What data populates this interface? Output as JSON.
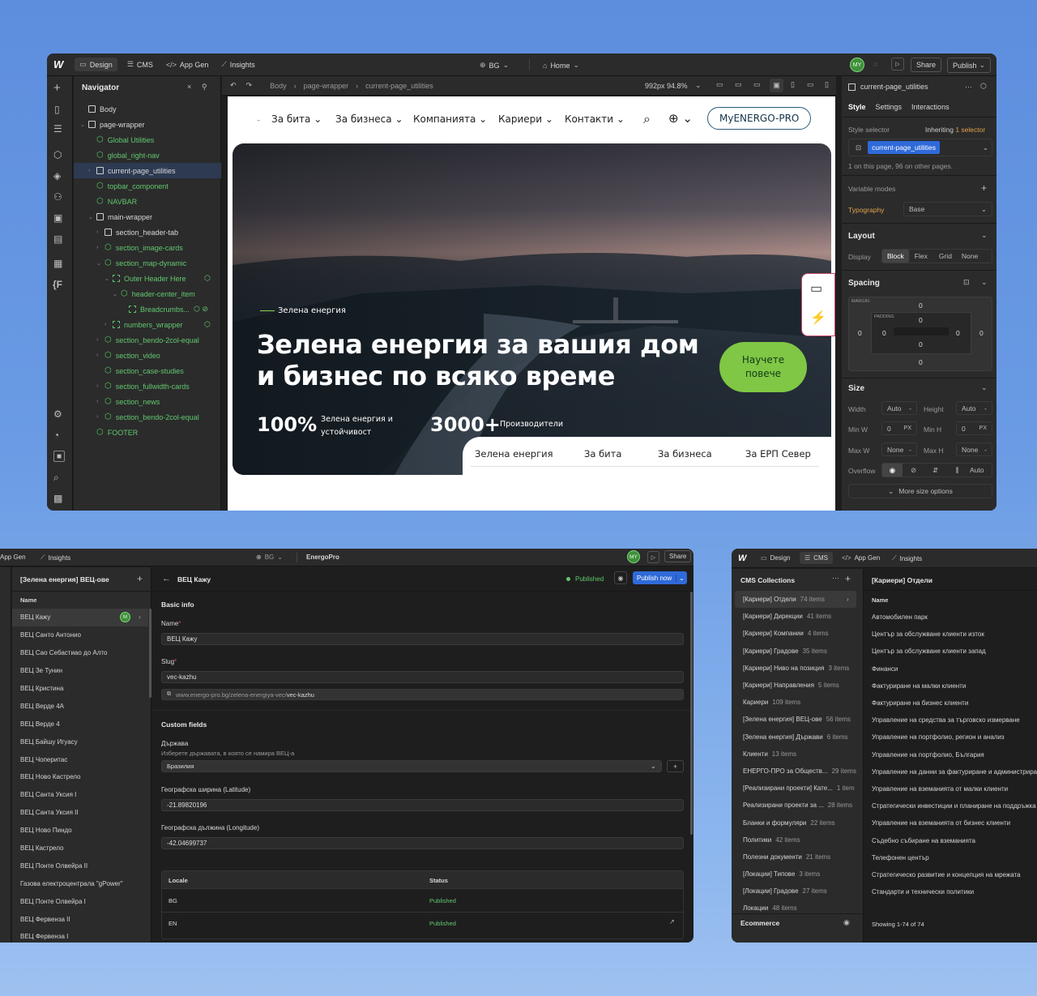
{
  "main": {
    "top": {
      "design": "Design",
      "cms": "CMS",
      "appgen": "App Gen",
      "insights": "Insights",
      "locale": "BG",
      "page": "Home",
      "avatar": "MY",
      "share": "Share",
      "publish": "Publish"
    },
    "navigator": {
      "title": "Navigator",
      "items": [
        {
          "label": "Body",
          "kind": "box",
          "depth": 0,
          "caret": ""
        },
        {
          "label": "page-wrapper",
          "kind": "box",
          "depth": 0,
          "caret": "v"
        },
        {
          "label": "Global Utilities",
          "kind": "comp",
          "depth": 1,
          "caret": ""
        },
        {
          "label": "global_right-nav",
          "kind": "comp",
          "depth": 1,
          "caret": ""
        },
        {
          "label": "current-page_utilities",
          "kind": "box",
          "depth": 1,
          "caret": ">",
          "selected": true
        },
        {
          "label": "topbar_component",
          "kind": "comp",
          "depth": 1,
          "caret": ""
        },
        {
          "label": "NAVBAR",
          "kind": "comp",
          "depth": 1,
          "caret": ""
        },
        {
          "label": "main-wrapper",
          "kind": "box",
          "depth": 1,
          "caret": "v"
        },
        {
          "label": "section_header-tab",
          "kind": "box",
          "depth": 2,
          "caret": ">"
        },
        {
          "label": "section_image-cards",
          "kind": "comp",
          "depth": 2,
          "caret": ">"
        },
        {
          "label": "section_map-dynamic",
          "kind": "comp",
          "depth": 2,
          "caret": "v"
        },
        {
          "label": "Outer Header Here",
          "kind": "dash",
          "depth": 3,
          "caret": "v"
        },
        {
          "label": "header-center_item",
          "kind": "comp",
          "depth": 4,
          "caret": "v"
        },
        {
          "label": "Breadcrumbs...",
          "kind": "dash",
          "depth": 5,
          "caret": ""
        },
        {
          "label": "numbers_wrapper",
          "kind": "dash",
          "depth": 3,
          "caret": ">"
        },
        {
          "label": "section_bendo-2col-equal",
          "kind": "comp",
          "depth": 2,
          "caret": ">"
        },
        {
          "label": "section_video",
          "kind": "comp",
          "depth": 2,
          "caret": ">"
        },
        {
          "label": "section_case-studies",
          "kind": "comp",
          "depth": 2,
          "caret": ""
        },
        {
          "label": "section_fullwidth-cards",
          "kind": "comp",
          "depth": 2,
          "caret": ">"
        },
        {
          "label": "section_news",
          "kind": "comp",
          "depth": 2,
          "caret": ">"
        },
        {
          "label": "section_bendo-2col-equal",
          "kind": "comp",
          "depth": 2,
          "caret": ">"
        },
        {
          "label": "FOOTER",
          "kind": "comp",
          "depth": 1,
          "caret": ""
        }
      ]
    },
    "crumbs": [
      "Body",
      "page-wrapper",
      "current-page_utilities"
    ],
    "viewport": "992px 94.8%",
    "site": {
      "nav": [
        "За бита",
        "За бизнеса",
        "Компанията",
        "Кариери",
        "Контакти"
      ],
      "cta": "MyENERGO-PRO",
      "eyebrow": "Зелена енергия",
      "headline1": "Зелена енергия за вашия дом",
      "headline2": "и бизнес по всяко време",
      "button": "Научете повече",
      "stat1_value": "100%",
      "stat1_label": "Зелена енергия и устойчивост",
      "stat2_value": "3000+",
      "stat2_label": "Производители",
      "tabs": [
        "Зелена енергия",
        "За бита",
        "За бизнеса",
        "За ЕРП Север"
      ]
    },
    "style": {
      "class_name": "current-page_utilities",
      "tabs": [
        "Style",
        "Settings",
        "Interactions"
      ],
      "selector_label": "Style selector",
      "inheriting": "Inheriting",
      "selector_count": "1 selector",
      "usage": "1 on this page, 96 on other pages.",
      "variable_modes": "Variable modes",
      "typography": "Typography",
      "base": "Base",
      "layout": "Layout",
      "display": "Display",
      "display_opts": [
        "Block",
        "Flex",
        "Grid",
        "None"
      ],
      "spacing": "Spacing",
      "margin": "MARGIN",
      "padding": "PADDING",
      "zero": "0",
      "size": "Size",
      "width": "Width",
      "height": "Height",
      "auto": "Auto",
      "minw": "Min W",
      "minh": "Min H",
      "maxw": "Max W",
      "maxh": "Max H",
      "none": "None",
      "px": "PX",
      "overflow": "Overflow",
      "more": "More size options"
    }
  },
  "cms_left": {
    "top": {
      "appgen": "App Gen",
      "insights": "Insights",
      "locale": "BG",
      "site": "EnergoPro",
      "avatar": "MY",
      "share": "Share"
    },
    "collection": "[Зелена енергия] ВЕЦ-ове",
    "name_header": "Name",
    "items": [
      "ВЕЦ Кажу",
      "ВЕЦ Санто Антонио",
      "ВЕЦ Сао Себастиао до Алто",
      "ВЕЦ Зе Тунин",
      "ВЕЦ Кристина",
      "ВЕЦ Верде 4А",
      "ВЕЦ Верде 4",
      "ВЕЦ Байшу Игуасу",
      "ВЕЦ Чоперитас",
      "ВЕЦ Ново Кастрело",
      "ВЕЦ Санта Уксия I",
      "ВЕЦ Санта Уксия II",
      "ВЕЦ Ново Пиндо",
      "ВЕЦ Кастрело",
      "ВЕЦ Понте Олвейра II",
      "Газова електроцентрала \"gPower\"",
      "ВЕЦ Понте Олвейра I",
      "ВЕЦ Фервенза II",
      "ВЕЦ Фервенза I"
    ],
    "item_title": "ВЕЦ Кажу",
    "status": "Published",
    "publish_now": "Publish now",
    "basic_info": "Basic info",
    "name_label": "Name",
    "name_value": "ВЕЦ Кажу",
    "slug_label": "Slug",
    "slug_value": "vec-kazhu",
    "url_prefix": "www.energo-pro.bg/zelena-energiya-vec/",
    "url_slug": "vec-kazhu",
    "custom_fields": "Custom fields",
    "country_label": "Държава",
    "country_help": "Изберете държавата, в която се намира ВЕЦ-а",
    "country_value": "Бразилия",
    "lat_label": "Географска ширина (Latitude)",
    "lat_value": "-21.89820196",
    "lng_label": "Географска дължина (Longitude)",
    "lng_value": "-42.04699737",
    "locale_header": "Locale",
    "status_header": "Status",
    "locales": [
      {
        "code": "BG",
        "status": "Published"
      },
      {
        "code": "EN",
        "status": "Published"
      }
    ]
  },
  "cms_right": {
    "top": {
      "design": "Design",
      "cms": "CMS",
      "appgen": "App Gen",
      "insights": "Insights"
    },
    "title": "CMS Collections",
    "collections": [
      {
        "name": "[Кариери] Отдели",
        "count": "74 items"
      },
      {
        "name": "[Кариери] Дирекции",
        "count": "41 items"
      },
      {
        "name": "[Кариери] Компании",
        "count": "4 items"
      },
      {
        "name": "[Кариери] Градове",
        "count": "35 items"
      },
      {
        "name": "[Кариери] Ниво на позиция",
        "count": "3 items"
      },
      {
        "name": "[Кариери] Направления",
        "count": "5 items"
      },
      {
        "name": "Кариери",
        "count": "109 items"
      },
      {
        "name": "[Зелена енергия] ВЕЦ-ове",
        "count": "56 items"
      },
      {
        "name": "[Зелена енергия] Държави",
        "count": "6 items"
      },
      {
        "name": "Клиенти",
        "count": "13 items"
      },
      {
        "name": "ЕНЕРГО-ПРО за Обществ...",
        "count": "29 items"
      },
      {
        "name": "[Реализирани проекти] Кате...",
        "count": "1 item"
      },
      {
        "name": "Реализирани проекти за ...",
        "count": "28 items"
      },
      {
        "name": "Бланки и формуляри",
        "count": "22 items"
      },
      {
        "name": "Политики",
        "count": "42 items"
      },
      {
        "name": "Полезни документи",
        "count": "21 items"
      },
      {
        "name": "[Локации] Типове",
        "count": "3 items"
      },
      {
        "name": "[Локации] Градове",
        "count": "27 items"
      },
      {
        "name": "Локации",
        "count": "48 items"
      }
    ],
    "ecommerce": "Ecommerce",
    "collection": "[Кариери] Отдели",
    "name_header": "Name",
    "items": [
      "Автомобилен парк",
      "Център за обслужване клиенти изток",
      "Център за обслужване клиенти запад",
      "Финанси",
      "Фактуриране на малки клиенти",
      "Фактуриране на бизнес клиенти",
      "Управление на средства за търговско измерване",
      "Управление на портфолио, регион и анализ",
      "Управление на портфолио, България",
      "Управление на данни за фактуриране и администриране",
      "Управление на вземанията от малки клиенти",
      "Стратегически инвестиции и планиране на поддръжка",
      "Управление на вземанията от бизнес клиенти",
      "Съдебно събиране на вземанията",
      "Телефонен център",
      "Стратегическо развитие и концепция на мрежата",
      "Стандарти и технически политики"
    ],
    "showing": "Showing 1-74 of 74"
  }
}
